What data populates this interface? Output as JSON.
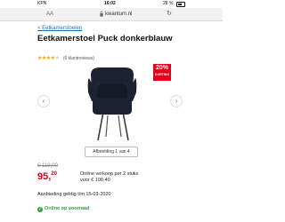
{
  "status_bar": {
    "carrier": "KPN",
    "time": "16:02",
    "battery": "28 %"
  },
  "browser": {
    "url": "kwantum.nl",
    "tabs_icon": "tabs-icon",
    "reload_icon": "reload-icon"
  },
  "breadcrumb": {
    "label": "< Eetkamerstoelen"
  },
  "product": {
    "title": "Eetkamerstoel Puck donkerblauw",
    "rating": {
      "filled_stars": 4,
      "total_stars": 5,
      "reviews": "(6 klantreviews)"
    },
    "badge": {
      "percent": "20%",
      "label": "KORTING"
    },
    "gallery": {
      "pagination": "Afbeelding 1 van 4",
      "prev_icon": "chevron-left-icon",
      "next_icon": "chevron-right-icon",
      "chair_color": "#1d2233"
    },
    "pricing": {
      "old_price": "€ 119,00",
      "price_euros": "95,",
      "price_cents": "20",
      "bulk_line1": "Online verkoop per 2 stuks",
      "bulk_line2": "voor   € 190,40",
      "valid_until": "Aanbieding geldig t/m 15-03-2020"
    },
    "stock": {
      "label": "Online op voorraad",
      "icon": "check-circle-icon"
    }
  },
  "colors": {
    "accent_red": "#e3001b",
    "link_blue": "#1f6fb2",
    "stock_green": "#2e9e3e",
    "star_yellow": "#f0a500"
  }
}
